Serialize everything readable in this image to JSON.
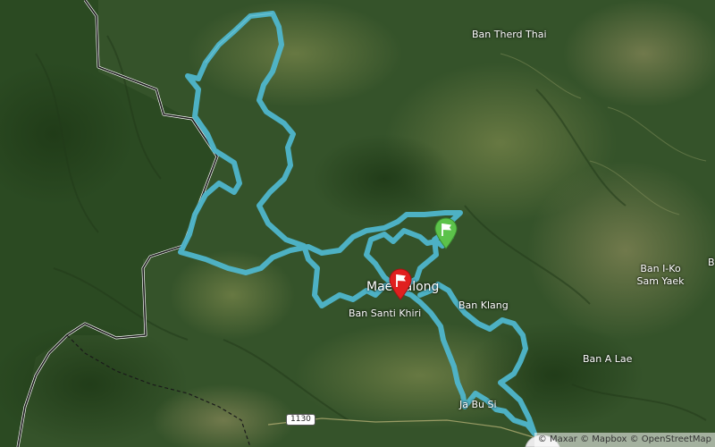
{
  "map": {
    "places": [
      {
        "id": "ban-therd-thai",
        "label": "Ban Therd Thai"
      },
      {
        "id": "mae-salong",
        "label": "Mae Salong"
      },
      {
        "id": "ban-santi-khiri",
        "label": "Ban Santi Khiri"
      },
      {
        "id": "ban-klang",
        "label": "Ban Klang"
      },
      {
        "id": "ban-i-ko-sam-yaek",
        "label": "Ban I-Ko Sam Yaek"
      },
      {
        "id": "ban-a-lae",
        "label": "Ban A Lae"
      },
      {
        "id": "ja-bu-si",
        "label": "Ja Bu Si"
      },
      {
        "id": "edge-b",
        "label": "B"
      }
    ],
    "road_shield": "1130",
    "route_color": "#4fb6cc",
    "start_marker": {
      "color": "#5cc24a",
      "icon": "flag-icon"
    },
    "end_marker": {
      "color": "#e0201f",
      "icon": "flag-icon"
    },
    "attribution": {
      "maxar": "© Maxar",
      "mapbox": "© Mapbox",
      "osm": "© OpenStreetMap"
    }
  }
}
